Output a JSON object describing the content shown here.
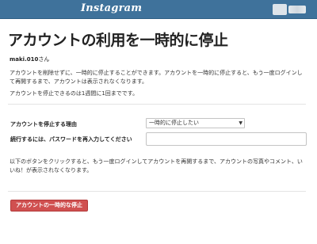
{
  "header": {
    "logo_text": "Instagram",
    "accent_color": "#3f729b"
  },
  "page": {
    "title": "アカウントの利用を一時的に停止"
  },
  "user": {
    "username": "maki.010",
    "honorific": "さん"
  },
  "description": {
    "text": "アカウントを削除せずに、一時的に停止することができます。アカウントを一時的に停止すると、もう一度ログインして再開するまで、アカウントは表示されなくなります。",
    "limit_text": "アカウントを停止できるのは1週間に1回までです。"
  },
  "form": {
    "reason_label": "アカウントを停止する理由",
    "reason_selected": "一時的に停止したい",
    "password_label": "続行するには、パスワードを再入力してください",
    "password_value": ""
  },
  "footer": {
    "note": "以下のボタンをクリックすると、もう一度ログインしてアカウントを再開するまで、アカウントの写真やコメント、いいね！が表示されなくなります。",
    "disable_button_label": "アカウントの一時的な停止",
    "button_color": "#d05050"
  }
}
